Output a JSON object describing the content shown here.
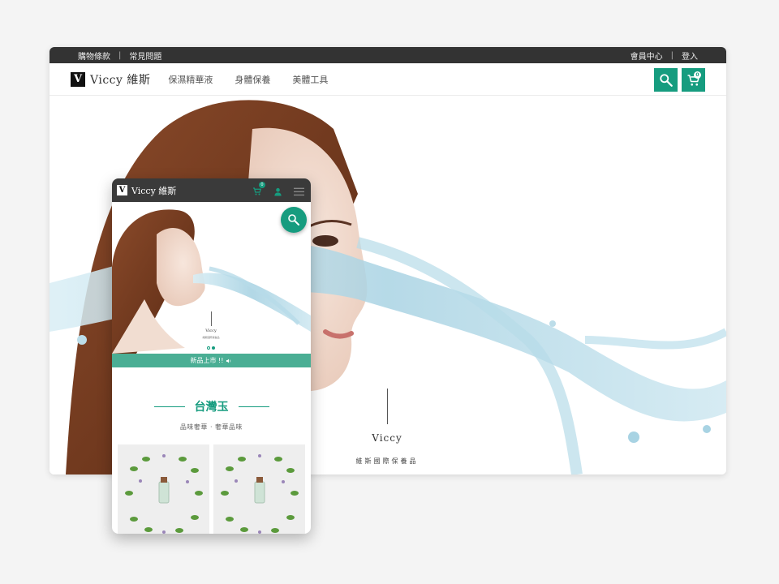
{
  "desktop": {
    "topbar": {
      "left_links": [
        "購物條款",
        "常見問題"
      ],
      "right_links": [
        "會員中心",
        "登入"
      ],
      "separator": "|"
    },
    "logo": {
      "mark": "V",
      "text": "Viccy 維斯"
    },
    "menu": [
      "保濕精華液",
      "身體保養",
      "美體工具"
    ],
    "cart_count": "0",
    "hero": {
      "brand": "Viccy",
      "subtitle": "維斯國際保養品"
    },
    "icons": [
      "search-icon",
      "cart-icon"
    ]
  },
  "mobile": {
    "logo": {
      "mark": "V",
      "text": "Viccy 維斯"
    },
    "cart_count": "0",
    "icons": [
      "cart-icon",
      "user-icon",
      "hamburger-icon",
      "search-icon"
    ],
    "hero": {
      "brand": "Viccy",
      "subtitle": "維斯國際保養品",
      "slides": 2,
      "active_slide": 1
    },
    "ticker": "新品上市 !!",
    "section": {
      "title": "台灣玉",
      "subtitle": "品味奢華 ‧ 奢華品味"
    }
  },
  "colors": {
    "accent": "#169c7f",
    "topbar": "#333333",
    "ticker": "#4aae94"
  }
}
